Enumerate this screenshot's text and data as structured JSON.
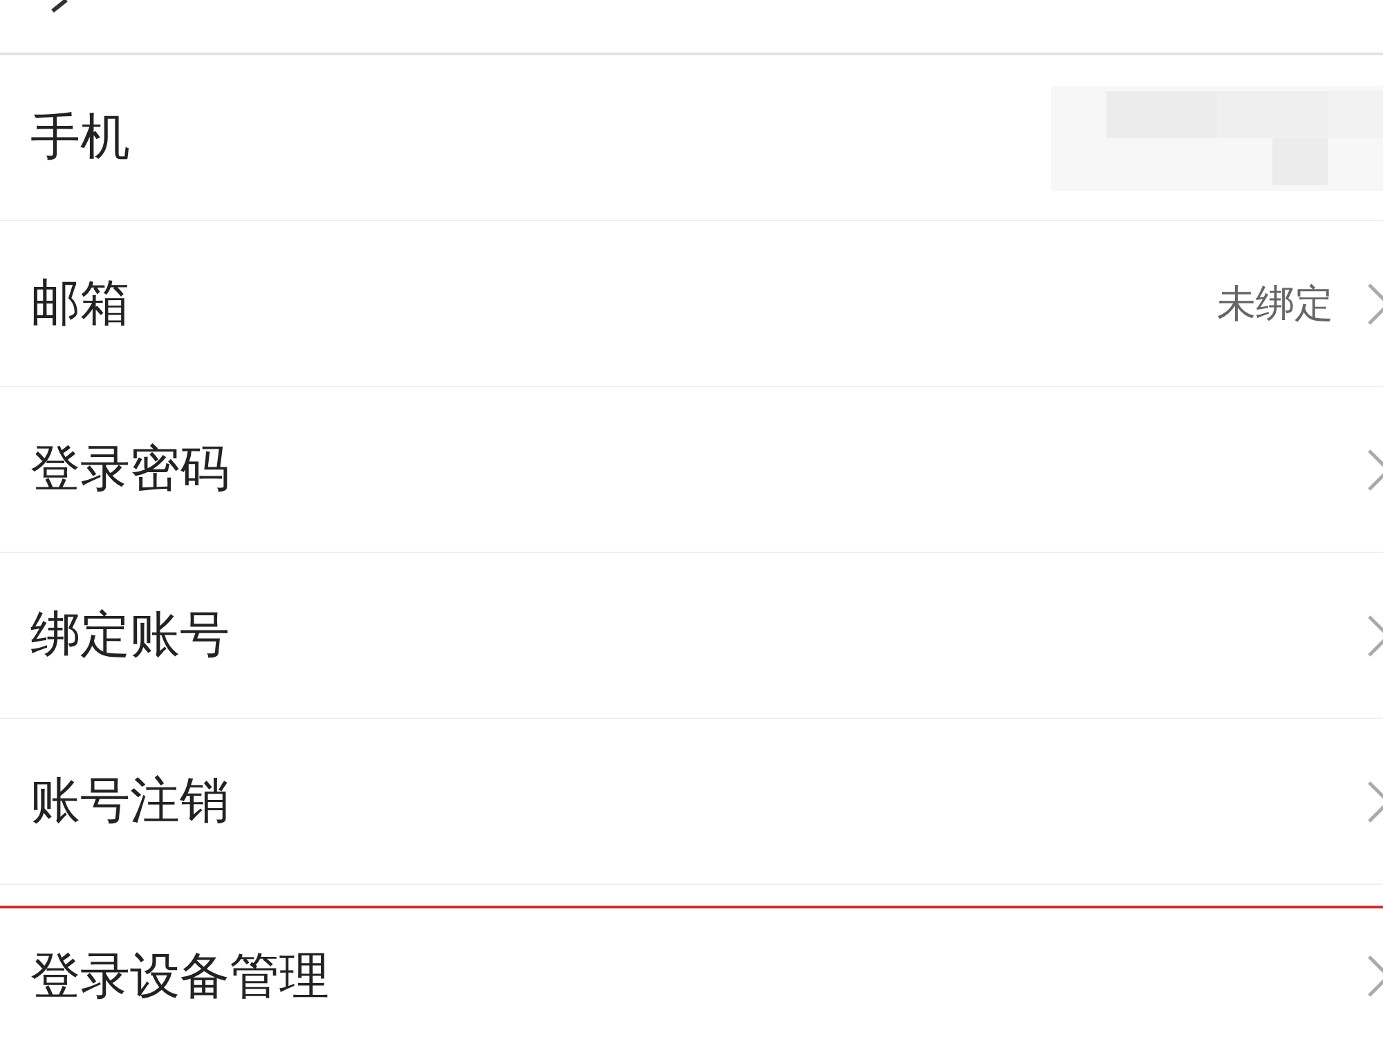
{
  "items": [
    {
      "label": "手机",
      "kind": "masked",
      "chevron": false,
      "highlighted": false
    },
    {
      "label": "邮箱",
      "kind": "value",
      "value": "未绑定",
      "chevron": true,
      "highlighted": false
    },
    {
      "label": "登录密码",
      "kind": "plain",
      "chevron": true,
      "highlighted": false
    },
    {
      "label": "绑定账号",
      "kind": "plain",
      "chevron": true,
      "highlighted": false
    },
    {
      "label": "账号注销",
      "kind": "plain",
      "chevron": true,
      "highlighted": false
    },
    {
      "label": "登录设备管理",
      "kind": "plain",
      "chevron": true,
      "highlighted": true
    }
  ]
}
